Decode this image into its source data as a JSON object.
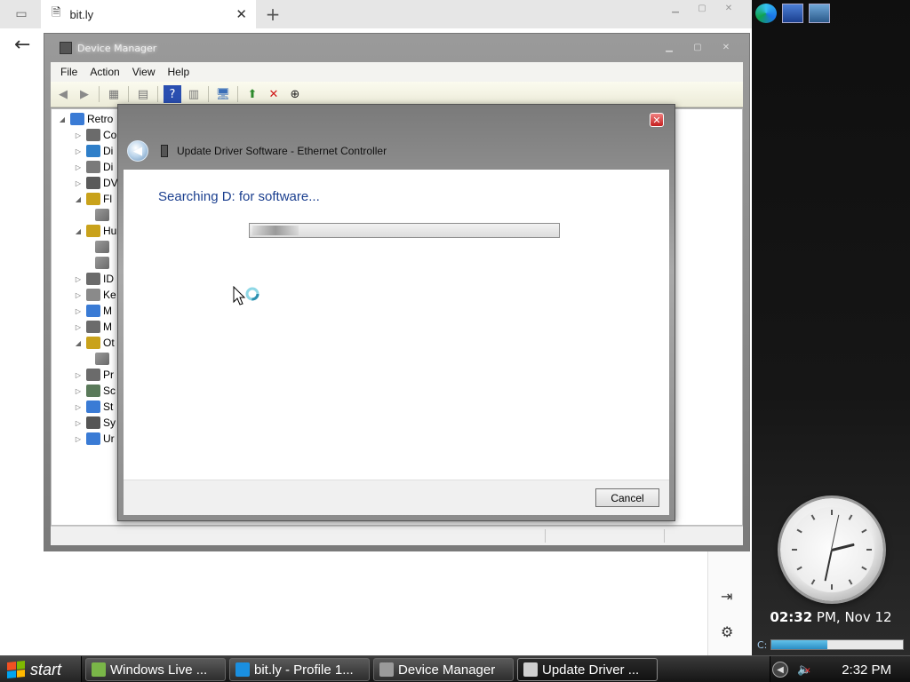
{
  "browser": {
    "tab_title": "bit.ly",
    "tab_close": "✕",
    "new_tab": "+",
    "back": "←"
  },
  "sidebar": {
    "clock_time": "02:32",
    "clock_suffix": " PM, Nov 12",
    "drive_label": "C:",
    "drive_fill_fraction": 0.42
  },
  "device_manager": {
    "title": "Device Manager",
    "menu": [
      "File",
      "Action",
      "View",
      "Help"
    ],
    "tree": [
      {
        "label": "Retro",
        "expanded": true,
        "root": true
      },
      {
        "label": "Co",
        "expanded": false
      },
      {
        "label": "Di",
        "expanded": false
      },
      {
        "label": "Di",
        "expanded": false
      },
      {
        "label": "DV",
        "expanded": false
      },
      {
        "label": "Fl",
        "expanded": true
      },
      {
        "label": "",
        "child": true
      },
      {
        "label": "Hu",
        "expanded": true
      },
      {
        "label": "",
        "child": true
      },
      {
        "label": "",
        "child": true
      },
      {
        "label": "ID",
        "expanded": false
      },
      {
        "label": "Ke",
        "expanded": false
      },
      {
        "label": "M",
        "expanded": false
      },
      {
        "label": "M",
        "expanded": false
      },
      {
        "label": "Ot",
        "expanded": true
      },
      {
        "label": "",
        "child": true
      },
      {
        "label": "Pr",
        "expanded": false
      },
      {
        "label": "Sc",
        "expanded": false
      },
      {
        "label": "St",
        "expanded": false
      },
      {
        "label": "Sy",
        "expanded": false
      },
      {
        "label": "Ur",
        "expanded": false
      }
    ]
  },
  "dialog": {
    "title": "Update Driver Software - Ethernet Controller",
    "heading": "Searching D: for software...",
    "cancel": "Cancel",
    "close": "✕"
  },
  "taskbar": {
    "start": "start",
    "tasks": [
      {
        "label": "Windows Live ...",
        "color": "#7ab648"
      },
      {
        "label": "bit.ly - Profile 1...",
        "color": "#1a8fe0"
      },
      {
        "label": "Device Manager",
        "color": "#9a9a9a"
      },
      {
        "label": "Update Driver ...",
        "color": "#cfcfcf"
      }
    ],
    "tray_time": "2:32 PM"
  }
}
